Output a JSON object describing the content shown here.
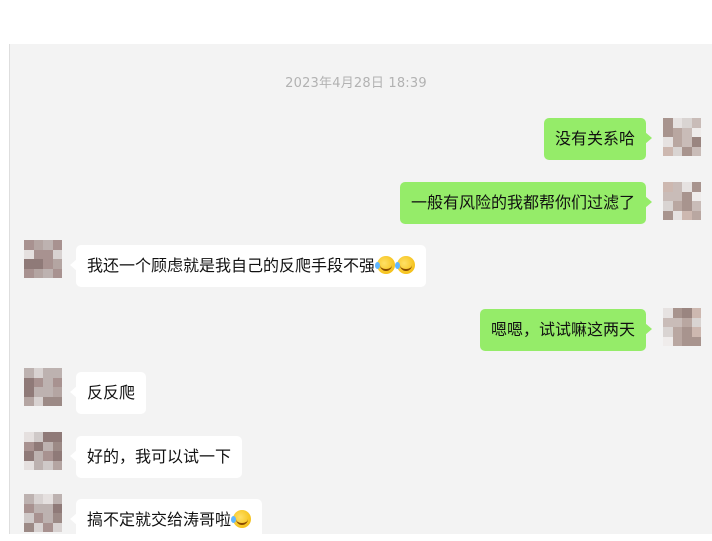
{
  "timestamp": "2023年4月28日 18:39",
  "messages": [
    {
      "side": "out",
      "text": "没有关系哈",
      "emoji_count": 0
    },
    {
      "side": "out",
      "text": "一般有风险的我都帮你们过滤了",
      "emoji_count": 0
    },
    {
      "side": "in",
      "text": "我还一个顾虑就是我自己的反爬手段不强",
      "emoji_count": 2,
      "emoji": "laughing-tears-emoji"
    },
    {
      "side": "out",
      "text": "嗯嗯，试试嘛这两天",
      "emoji_count": 0
    },
    {
      "side": "in",
      "text": "反反爬",
      "emoji_count": 0
    },
    {
      "side": "in",
      "text": "好的，我可以试一下",
      "emoji_count": 0
    },
    {
      "side": "in",
      "text": "搞不定就交给涛哥啦",
      "emoji_count": 1,
      "emoji": "laughing-tears-emoji"
    }
  ],
  "colors": {
    "outgoing_bubble": "#95ec69",
    "incoming_bubble": "#ffffff",
    "chat_background": "#f3f3f3",
    "timestamp_text": "#b2b2b2"
  }
}
